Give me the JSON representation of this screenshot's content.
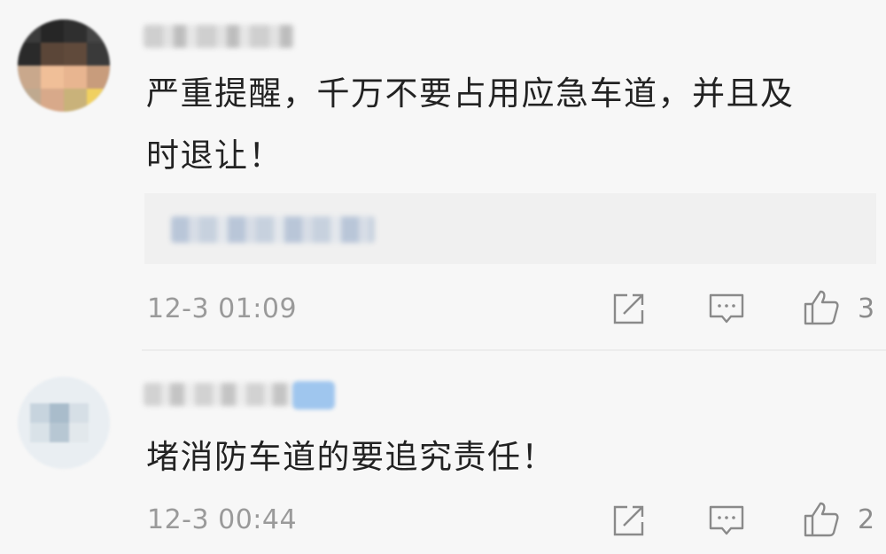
{
  "comments": [
    {
      "text_lines": [
        "严重提醒，千万不要占用应急车道，并且及",
        "时退让！"
      ],
      "timestamp": "12-3 01:09",
      "like_count": "3",
      "has_reply_preview": true
    },
    {
      "text_lines": [
        "堵消防车道的要追究责任！"
      ],
      "timestamp": "12-3 00:44",
      "like_count": "2",
      "has_reply_preview": false
    }
  ],
  "icons": {
    "share": "share-icon",
    "reply": "comment-icon",
    "like": "thumbs-up-icon"
  },
  "colors": {
    "background": "#f7f7f7",
    "text": "#222222",
    "meta": "#9a9a9a",
    "reply_box": "#f0f0f0"
  }
}
